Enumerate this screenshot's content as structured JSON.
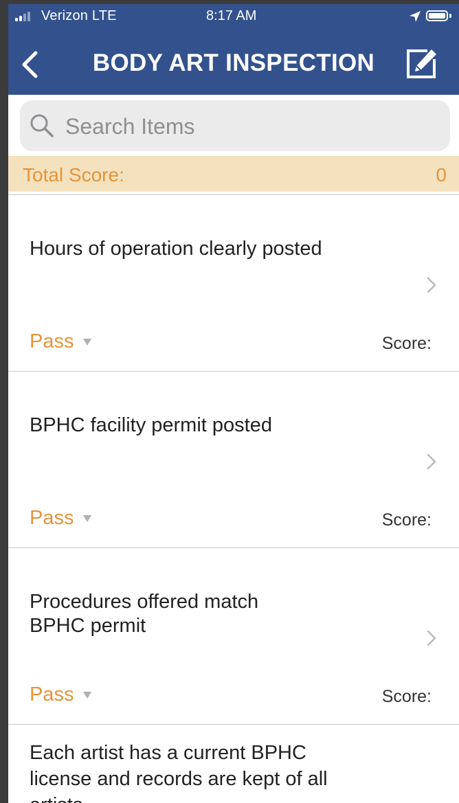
{
  "status_bar": {
    "carrier": "Verizon  LTE",
    "time": "8:17 AM"
  },
  "header": {
    "title": "BODY ART INSPECTION",
    "bg_color": "#33528d"
  },
  "search": {
    "placeholder": "Search Items"
  },
  "total_score": {
    "label": "Total Score:",
    "value": "0"
  },
  "items": [
    {
      "text": "Hours of operation clearly posted",
      "status": "Pass",
      "score_label": "Score:"
    },
    {
      "text": "BPHC facility permit posted",
      "status": "Pass",
      "score_label": "Score:"
    },
    {
      "text": "Procedures offered match BPHC permit",
      "status": "Pass",
      "score_label": "Score:"
    },
    {
      "text": "Each artist has a current BPHC license and records are kept of all artists"
    }
  ],
  "colors": {
    "accent_orange": "#e89338",
    "total_bar_bg": "#f4e2bf"
  }
}
